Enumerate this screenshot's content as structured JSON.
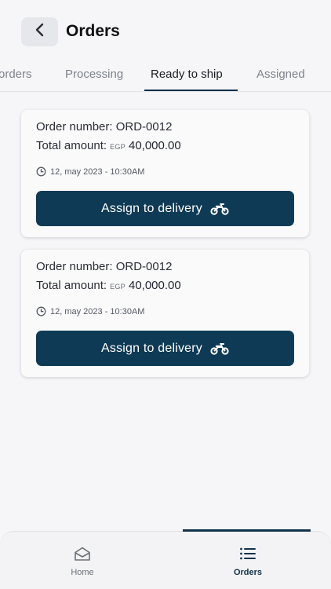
{
  "header": {
    "title": "Orders"
  },
  "tabs": [
    {
      "label": "orders"
    },
    {
      "label": "Processing"
    },
    {
      "label": "Ready to ship"
    },
    {
      "label": "Assigned"
    }
  ],
  "active_tab": "Ready to ship",
  "orders": [
    {
      "order_label": "Order number:",
      "order_number": "ORD-0012",
      "total_label": "Total amount:",
      "currency": "EGP",
      "amount": "40,000.00",
      "date": "12, may 2023 - 10:30AM",
      "button_label": "Assign to delivery"
    },
    {
      "order_label": "Order number:",
      "order_number": "ORD-0012",
      "total_label": "Total amount:",
      "currency": "EGP",
      "amount": "40,000.00",
      "date": "12, may 2023 - 10:30AM",
      "button_label": "Assign to delivery"
    }
  ],
  "bottom_nav": {
    "items": [
      {
        "label": "Home",
        "icon": "home-icon"
      },
      {
        "label": "Orders",
        "icon": "list-icon"
      }
    ],
    "active": "Orders"
  },
  "colors": {
    "accent": "#0f3a55",
    "background": "#f6f6f8",
    "card": "#fafafb"
  }
}
